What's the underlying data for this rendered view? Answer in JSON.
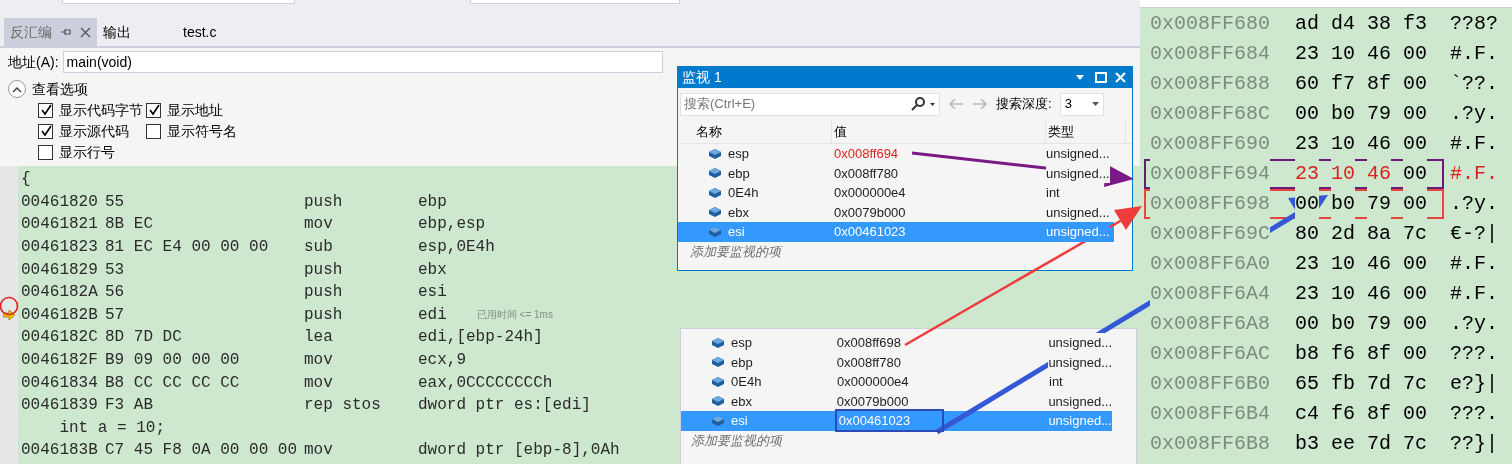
{
  "tabs": [
    {
      "label": "反汇编",
      "selected": true
    },
    {
      "label": "输出",
      "selected": false
    },
    {
      "label": "test.c",
      "selected": false
    }
  ],
  "address_bar": {
    "label": "地址(A):",
    "value": "main(void)"
  },
  "view_options": {
    "title": "查看选项",
    "expanded": true,
    "checkboxes": [
      {
        "label": "显示代码字节",
        "checked": true
      },
      {
        "label": "显示地址",
        "checked": true
      },
      {
        "label": "显示源代码",
        "checked": true
      },
      {
        "label": "显示符号名",
        "checked": false
      },
      {
        "label": "显示行号",
        "checked": false
      }
    ]
  },
  "disassembly": {
    "lines": [
      {
        "kind": "source",
        "text": "{"
      },
      {
        "kind": "instruction",
        "address": "00461820",
        "bytes": "55",
        "mnemonic": "push",
        "operands": "ebp",
        "current": false
      },
      {
        "kind": "instruction",
        "address": "00461821",
        "bytes": "8B EC",
        "mnemonic": "mov",
        "operands": "ebp,esp",
        "current": false
      },
      {
        "kind": "instruction",
        "address": "00461823",
        "bytes": "81 EC E4 00 00 00",
        "mnemonic": "sub",
        "operands": "esp,0E4h",
        "current": false
      },
      {
        "kind": "instruction",
        "address": "00461829",
        "bytes": "53",
        "mnemonic": "push",
        "operands": "ebx",
        "current": false
      },
      {
        "kind": "instruction",
        "address": "0046182A",
        "bytes": "56",
        "mnemonic": "push",
        "operands": "esi",
        "current": false
      },
      {
        "kind": "instruction",
        "address": "0046182B",
        "bytes": "57",
        "mnemonic": "push",
        "operands": "edi",
        "current": true,
        "hint": "已用时间 <= 1ms"
      },
      {
        "kind": "instruction",
        "address": "0046182C",
        "bytes": "8D 7D DC",
        "mnemonic": "lea",
        "operands": "edi,[ebp-24h]",
        "current": false
      },
      {
        "kind": "instruction",
        "address": "0046182F",
        "bytes": "B9 09 00 00 00",
        "mnemonic": "mov",
        "operands": "ecx,9",
        "current": false
      },
      {
        "kind": "instruction",
        "address": "00461834",
        "bytes": "B8 CC CC CC CC",
        "mnemonic": "mov",
        "operands": "eax,0CCCCCCCCh",
        "current": false
      },
      {
        "kind": "instruction",
        "address": "00461839",
        "bytes": "F3 AB",
        "mnemonic": "rep stos",
        "operands": "dword ptr es:[edi]",
        "current": false
      },
      {
        "kind": "source",
        "text": "    int a = 10;"
      },
      {
        "kind": "instruction",
        "address": "0046183B",
        "bytes": "C7 45 F8 0A 00 00 00",
        "mnemonic": "mov",
        "operands": "dword ptr [ebp-8],0Ah",
        "current": false
      }
    ]
  },
  "watch_window": {
    "title": "监视 1",
    "search_placeholder": "搜索(Ctrl+E)",
    "depth_label": "搜索深度:",
    "depth_value": "3",
    "columns": [
      "名称",
      "值",
      "类型"
    ],
    "rows": [
      {
        "name": "esp",
        "value": "0x008ff694",
        "type": "unsigned...",
        "changed": true,
        "selected": false
      },
      {
        "name": "ebp",
        "value": "0x008ff780",
        "type": "unsigned...",
        "changed": false,
        "selected": false
      },
      {
        "name": "0E4h",
        "value": "0x000000e4",
        "type": "int",
        "changed": false,
        "selected": false
      },
      {
        "name": "ebx",
        "value": "0x0079b000",
        "type": "unsigned...",
        "changed": false,
        "selected": false
      },
      {
        "name": "esi",
        "value": "0x00461023",
        "type": "unsigned...",
        "changed": false,
        "selected": true
      }
    ],
    "add_item": "添加要监视的项"
  },
  "watch_snapshot": {
    "rows": [
      {
        "name": "esp",
        "value": "0x008ff698",
        "type": "unsigned...",
        "selected": false,
        "outlined": false
      },
      {
        "name": "ebp",
        "value": "0x008ff780",
        "type": "unsigned...",
        "selected": false,
        "outlined": false
      },
      {
        "name": "0E4h",
        "value": "0x000000e4",
        "type": "int",
        "selected": false,
        "outlined": false
      },
      {
        "name": "ebx",
        "value": "0x0079b000",
        "type": "unsigned...",
        "selected": false,
        "outlined": false
      },
      {
        "name": "esi",
        "value": "0x00461023",
        "type": "unsigned...",
        "selected": true,
        "outlined": true
      }
    ],
    "add_item": "添加要监视的项"
  },
  "memory": {
    "rows": [
      {
        "address": "0x008FF680",
        "bytes": [
          {
            "text": "ad",
            "changed": false
          },
          {
            "text": "d4",
            "changed": false
          },
          {
            "text": "38",
            "changed": false
          },
          {
            "text": "f3",
            "changed": false
          }
        ],
        "ascii": "??8?",
        "ascii_changed": false
      },
      {
        "address": "0x008FF684",
        "bytes": [
          {
            "text": "23",
            "changed": false
          },
          {
            "text": "10",
            "changed": false
          },
          {
            "text": "46",
            "changed": false
          },
          {
            "text": "00",
            "changed": false
          }
        ],
        "ascii": "#.F.",
        "ascii_changed": false
      },
      {
        "address": "0x008FF688",
        "bytes": [
          {
            "text": "60",
            "changed": false
          },
          {
            "text": "f7",
            "changed": false
          },
          {
            "text": "8f",
            "changed": false
          },
          {
            "text": "00",
            "changed": false
          }
        ],
        "ascii": "`??.",
        "ascii_changed": false
      },
      {
        "address": "0x008FF68C",
        "bytes": [
          {
            "text": "00",
            "changed": false
          },
          {
            "text": "b0",
            "changed": false
          },
          {
            "text": "79",
            "changed": false
          },
          {
            "text": "00",
            "changed": false
          }
        ],
        "ascii": ".?y.",
        "ascii_changed": false
      },
      {
        "address": "0x008FF690",
        "bytes": [
          {
            "text": "23",
            "changed": false
          },
          {
            "text": "10",
            "changed": false
          },
          {
            "text": "46",
            "changed": false
          },
          {
            "text": "00",
            "changed": false
          }
        ],
        "ascii": "#.F.",
        "ascii_changed": false
      },
      {
        "address": "0x008FF694",
        "bytes": [
          {
            "text": "23",
            "changed": true
          },
          {
            "text": "10",
            "changed": true
          },
          {
            "text": "46",
            "changed": true
          },
          {
            "text": "00",
            "changed": false
          }
        ],
        "ascii": "#.F.",
        "ascii_changed": true,
        "color": "#6a1b7a"
      },
      {
        "address": "0x008FF698",
        "bytes": [
          {
            "text": "00",
            "changed": false
          },
          {
            "text": "b0",
            "changed": false
          },
          {
            "text": "79",
            "changed": false
          },
          {
            "text": "00",
            "changed": false
          }
        ],
        "ascii": ".?y.",
        "ascii_changed": false,
        "color": "#e8453c"
      },
      {
        "address": "0x008FF69C",
        "bytes": [
          {
            "text": "80",
            "changed": false
          },
          {
            "text": "2d",
            "changed": false
          },
          {
            "text": "8a",
            "changed": false
          },
          {
            "text": "7c",
            "changed": false
          }
        ],
        "ascii": "€-?|",
        "ascii_changed": false
      },
      {
        "address": "0x008FF6A0",
        "bytes": [
          {
            "text": "23",
            "changed": false
          },
          {
            "text": "10",
            "changed": false
          },
          {
            "text": "46",
            "changed": false
          },
          {
            "text": "00",
            "changed": false
          }
        ],
        "ascii": "#.F.",
        "ascii_changed": false
      },
      {
        "address": "0x008FF6A4",
        "bytes": [
          {
            "text": "23",
            "changed": false
          },
          {
            "text": "10",
            "changed": false
          },
          {
            "text": "46",
            "changed": false
          },
          {
            "text": "00",
            "changed": false
          }
        ],
        "ascii": "#.F.",
        "ascii_changed": false
      },
      {
        "address": "0x008FF6A8",
        "bytes": [
          {
            "text": "00",
            "changed": false
          },
          {
            "text": "b0",
            "changed": false
          },
          {
            "text": "79",
            "changed": false
          },
          {
            "text": "00",
            "changed": false
          }
        ],
        "ascii": ".?y.",
        "ascii_changed": false
      },
      {
        "address": "0x008FF6AC",
        "bytes": [
          {
            "text": "b8",
            "changed": false
          },
          {
            "text": "f6",
            "changed": false
          },
          {
            "text": "8f",
            "changed": false
          },
          {
            "text": "00",
            "changed": false
          }
        ],
        "ascii": "???.",
        "ascii_changed": false
      },
      {
        "address": "0x008FF6B0",
        "bytes": [
          {
            "text": "65",
            "changed": false
          },
          {
            "text": "fb",
            "changed": false
          },
          {
            "text": "7d",
            "changed": false
          },
          {
            "text": "7c",
            "changed": false
          }
        ],
        "ascii": "e?}|",
        "ascii_changed": false
      },
      {
        "address": "0x008FF6B4",
        "bytes": [
          {
            "text": "c4",
            "changed": false
          },
          {
            "text": "f6",
            "changed": false
          },
          {
            "text": "8f",
            "changed": false
          },
          {
            "text": "00",
            "changed": false
          }
        ],
        "ascii": "???.",
        "ascii_changed": false
      },
      {
        "address": "0x008FF6B8",
        "bytes": [
          {
            "text": "b3",
            "changed": false
          },
          {
            "text": "ee",
            "changed": false
          },
          {
            "text": "7d",
            "changed": false
          },
          {
            "text": "7c",
            "changed": false
          }
        ],
        "ascii": "??}|",
        "ascii_changed": false
      }
    ]
  }
}
